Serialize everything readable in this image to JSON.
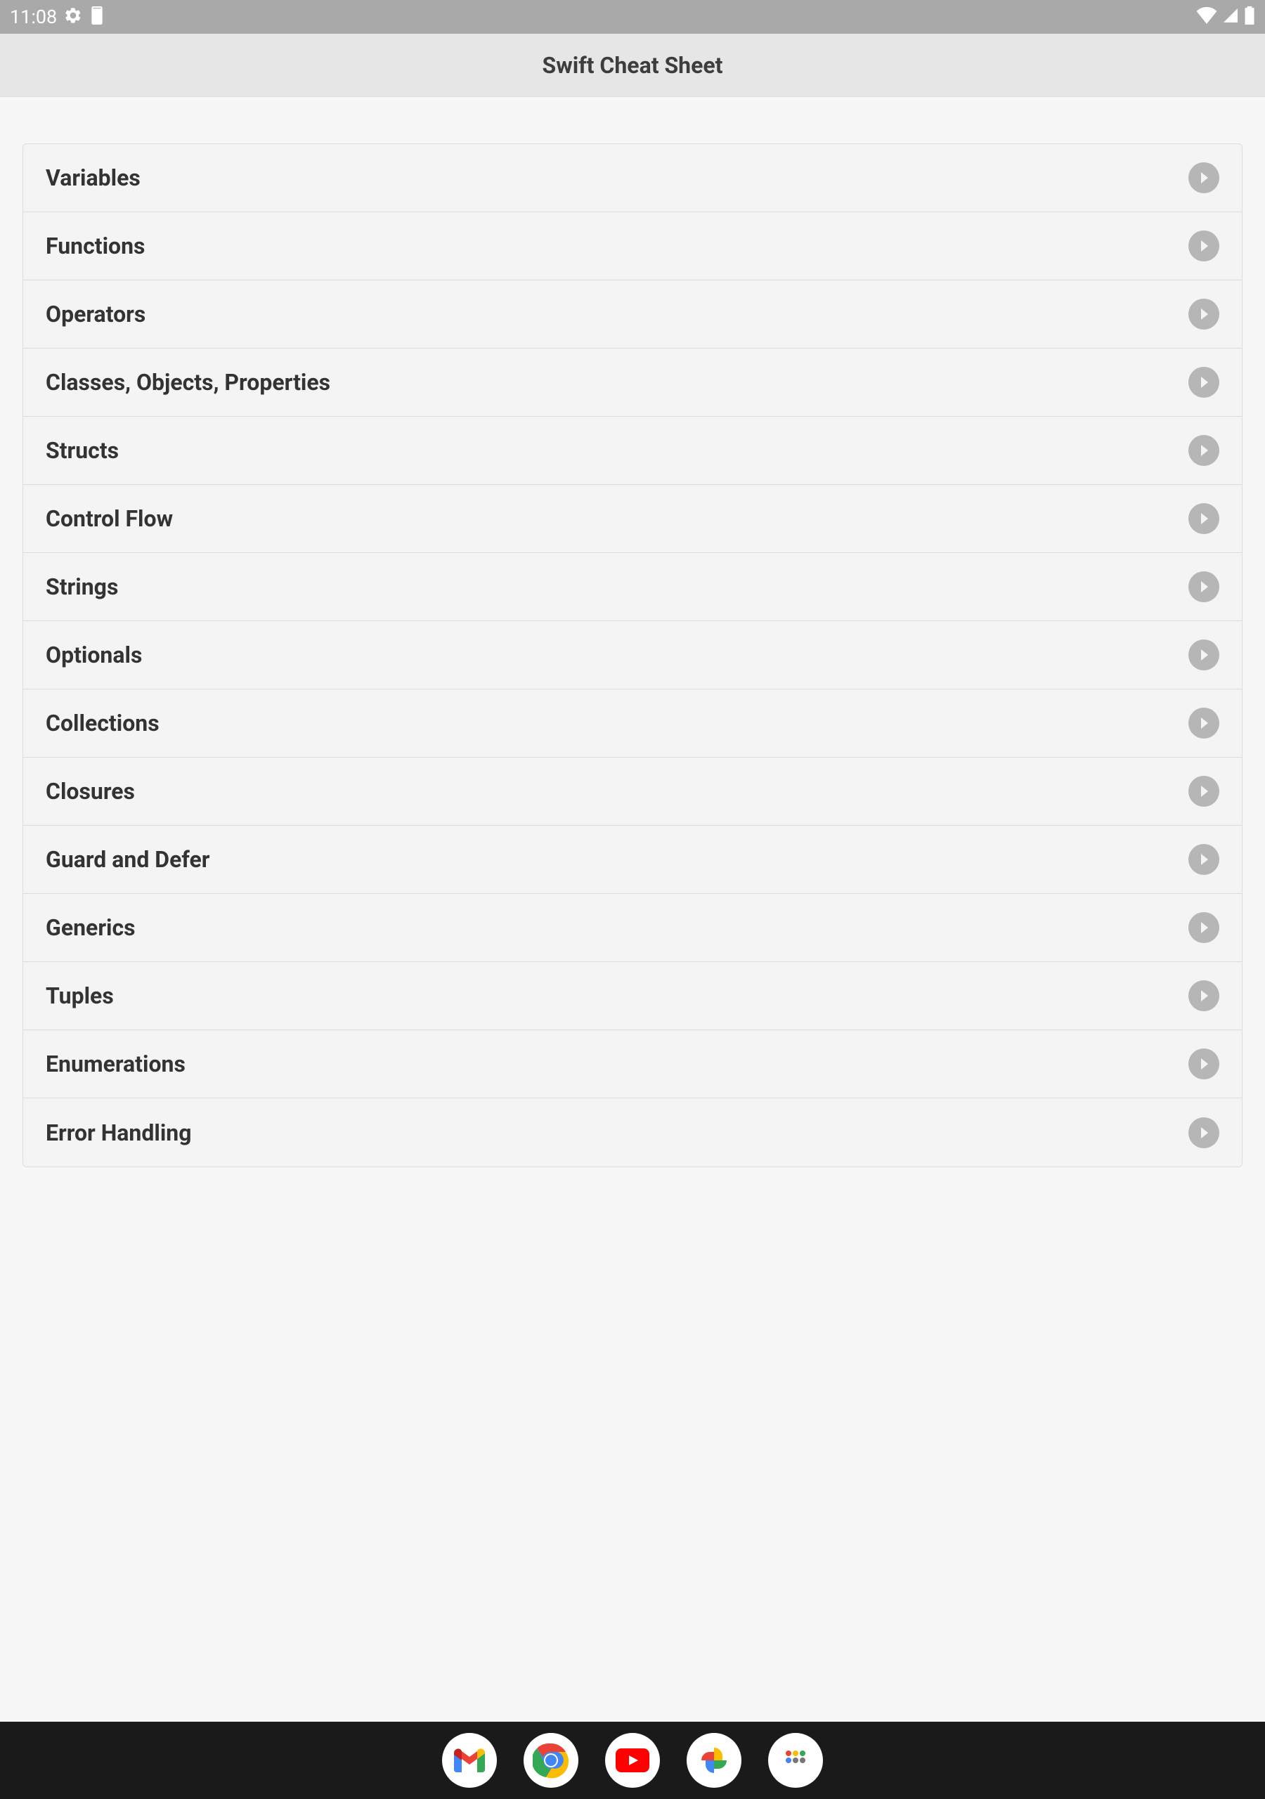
{
  "status_bar": {
    "time": "11:08"
  },
  "header": {
    "title": "Swift Cheat Sheet"
  },
  "list": {
    "items": [
      {
        "label": "Variables"
      },
      {
        "label": "Functions"
      },
      {
        "label": "Operators"
      },
      {
        "label": "Classes, Objects, Properties"
      },
      {
        "label": "Structs"
      },
      {
        "label": "Control Flow"
      },
      {
        "label": "Strings"
      },
      {
        "label": "Optionals"
      },
      {
        "label": "Collections"
      },
      {
        "label": "Closures"
      },
      {
        "label": "Guard and Defer"
      },
      {
        "label": "Generics"
      },
      {
        "label": "Tuples"
      },
      {
        "label": "Enumerations"
      },
      {
        "label": "Error Handling"
      }
    ]
  },
  "dock": {
    "apps": [
      "gmail",
      "chrome",
      "youtube",
      "photos",
      "apps"
    ]
  }
}
